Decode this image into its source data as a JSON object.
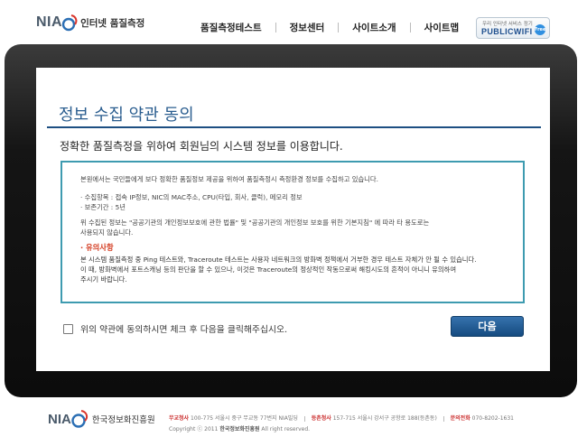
{
  "header": {
    "logo_nia": "NIA",
    "logo_sub": "인터넷 품질측정",
    "nav": [
      "품질측정테스트",
      "정보센터",
      "사이트소개",
      "사이트맵"
    ],
    "public_small": "우리 인터넷 서비스 정기",
    "public_big": "PUBLICWIFI",
    "public_badge": "Free"
  },
  "main": {
    "title": "정보 수집 약관 동의",
    "subtitle": "정확한 품질측정을 위하여 회원님의 시스템 정보를 이용합니다.",
    "terms": {
      "intro": "본원에서는 국민들에게 보다 정확한 품질정보 제공을 위하여 품질측정시 측정환경 정보를 수집하고 있습니다.",
      "item1": "· 수집항목 : 접속 IP정보, NIC의 MAC주소, CPU(타입, 회사, 클럭), 메모리 정보",
      "item2": "· 보존기간 : 5년",
      "law1": "위 수집된 정보는 \"공공기관의 개인정보보호에 관한 법률\" 및 \"공공기관의 개인정보 보호를 위한 기본지침\" 에 따라 타 용도로는",
      "law2": "사용되지 않습니다.",
      "caution_heading": "· 유의사항",
      "caution1": "본 시스템 품질측정 중 Ping 테스트와, Traceroute 테스트는 사용자 네트워크의 방화벽 정책에서 거부한 경우 테스트 자체가 안 될 수 있습니다.",
      "caution2": "이 때, 방화벽에서 포트스캐닝 등의 판단을 할 수 있으나, 이것은 Traceroute의 정상적인 작동으로써 해킹시도의 흔적이 아니니 유의하여",
      "caution3": "주시기 바랍니다."
    },
    "agree_label": "위의 약관에 동의하시면 체크 후 다음을 클릭해주십시오.",
    "agree_checked": false,
    "next_label": "다음"
  },
  "footer": {
    "nia": "NIA",
    "org": "한국정보화진흥원",
    "hq_label": "무교청사",
    "hq_addr": "100-775 서울시 중구 무교동 77번지 NIA빌딩",
    "branch_label": "등촌청사",
    "branch_addr": "157-715 서울시 강서구 공항로 188(등촌동)",
    "phone_label": "문의전화",
    "phone": "070-8202-1631",
    "copyright_prefix": "Copyright ⓒ 2011",
    "copyright_org": "한국정보화진흥원",
    "copyright_suffix": "All right reserved."
  },
  "colors": {
    "title": "#2a5d8f",
    "rule": "#1d4f82",
    "terms_border": "#3e9bb0",
    "caution": "#d33a1f",
    "button": "#1d578f"
  }
}
